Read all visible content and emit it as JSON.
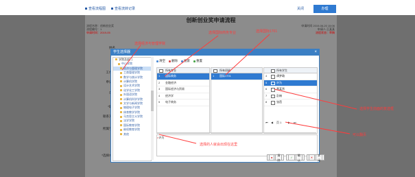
{
  "topbar": {
    "tab1": "查看流程图",
    "tab2": "查看流转记录",
    "close": "关闭",
    "submit": "办理"
  },
  "form": {
    "title": "创新创业奖申请流程",
    "left_lines": [
      "流程名称：创新创业奖",
      "流程编号：1",
      "申请时间：2019-05"
    ],
    "right_lines": [
      "申请时间 2019-06-20 15:06",
      "申请人:王某某",
      "流程状态：草稿"
    ],
    "labels": [
      "姓名",
      "工作号",
      "申请人",
      "年级",
      "*职称",
      "联系方式",
      "所属学院",
      "*选择本人"
    ]
  },
  "dialog": {
    "title": "学生选择器",
    "tree": [
      {
        "label": "学院及部门",
        "level": "root"
      },
      {
        "label": "中山学院",
        "level": "l1"
      },
      {
        "label": "经济与管理学院",
        "level": "l2",
        "selected": true
      },
      {
        "label": "工商管理学院",
        "level": "l2"
      },
      {
        "label": "数学与统计学院",
        "level": "l2"
      },
      {
        "label": "计算机学院",
        "level": "l2"
      },
      {
        "label": "设计艺术学院",
        "level": "l2"
      },
      {
        "label": "化学化工学院",
        "level": "l2"
      },
      {
        "label": "外国语学院",
        "level": "l2"
      },
      {
        "label": "计算机科学学院",
        "level": "l2"
      },
      {
        "label": "文学与新闻学院",
        "level": "l2"
      },
      {
        "label": "物理电子学院",
        "level": "l2"
      },
      {
        "label": "体育教学学院",
        "level": "l2"
      },
      {
        "label": "马克思主义学院",
        "level": "l2"
      },
      {
        "label": "法学学院",
        "level": "l2"
      },
      {
        "label": "国际教育学院",
        "level": "l2"
      },
      {
        "label": "继续教育学院",
        "level": "l2"
      },
      {
        "label": "其他",
        "level": "l2"
      }
    ],
    "toolbar": [
      "清空",
      "删除",
      "搜索",
      "重置"
    ],
    "grid1": {
      "header": "所有专业",
      "rows": [
        {
          "n": "1",
          "t": "国际商务",
          "sel": true
        },
        {
          "n": "2",
          "t": "金融经济"
        },
        {
          "n": "3",
          "t": "国际经济与贸易"
        },
        {
          "n": "4",
          "t": "经济学"
        },
        {
          "n": "5",
          "t": "电子商务"
        }
      ]
    },
    "grid2": {
      "header": "所有班级",
      "rows": [
        {
          "n": "1",
          "t": "国际1701",
          "sel": true
        }
      ]
    },
    "grid3": {
      "header": "所有学生",
      "rows": [
        {
          "n": "4",
          "t": "谭梦璐"
        },
        {
          "n": "5",
          "t": "许为",
          "sel": true,
          "checked": true
        },
        {
          "n": "6",
          "t": "黄某然"
        },
        {
          "n": "7",
          "t": "彭楠"
        },
        {
          "n": "8",
          "t": "张蓓"
        }
      ]
    },
    "pager": "页 1",
    "selected_chip": "许为",
    "buttons": [
      "清除",
      "确认",
      "关闭"
    ]
  },
  "annotations": {
    "a1": "选择经济与管理学院",
    "a2": "选择国际商务专业",
    "a3": "选择国际1701",
    "a4": "选择学生前面的复选框",
    "a5": "可以翻页",
    "a6": "选择的人就会出现在这里"
  },
  "colors": {
    "accent": "#2f7ad1",
    "annotation": "#ff3b3b",
    "folder": "#e8b84a"
  }
}
